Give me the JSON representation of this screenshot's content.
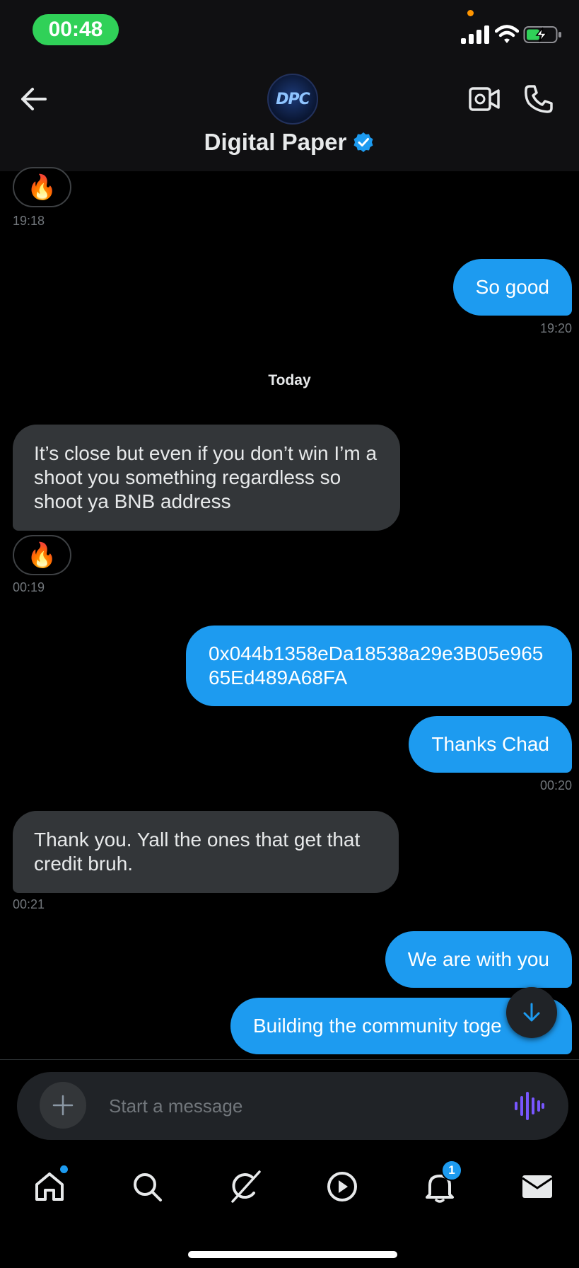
{
  "status_bar": {
    "time": "00:48"
  },
  "header": {
    "contact_name": "Digital Paper",
    "avatar_text": "DPC",
    "verified": true
  },
  "messages": {
    "m0": {
      "reaction": "🔥",
      "timestamp": "19:18"
    },
    "m1": {
      "text": "So good",
      "timestamp": "19:20"
    },
    "day_separator": "Today",
    "m2": {
      "text": "It’s close but even if you don’t win I’m a shoot you something regardless so shoot ya BNB address",
      "reaction": "🔥",
      "timestamp": "00:19"
    },
    "m3": {
      "text": "0x044b1358eDa18538a29e3B05e96565Ed489A68FA"
    },
    "m4": {
      "text": "Thanks Chad",
      "timestamp": "00:20"
    },
    "m5": {
      "text": "Thank you. Yall the ones that get that credit bruh.",
      "timestamp": "00:21"
    },
    "m6": {
      "text": "We are with you"
    },
    "m7": {
      "text": "Building the community toge"
    }
  },
  "composer": {
    "placeholder": "Start a message"
  },
  "nav": {
    "notifications_badge": "1"
  },
  "colors": {
    "accent": "#1d9bf0",
    "incoming_bubble": "#333639",
    "voice_icon": "#7856ff",
    "time_pill": "#30d158"
  }
}
